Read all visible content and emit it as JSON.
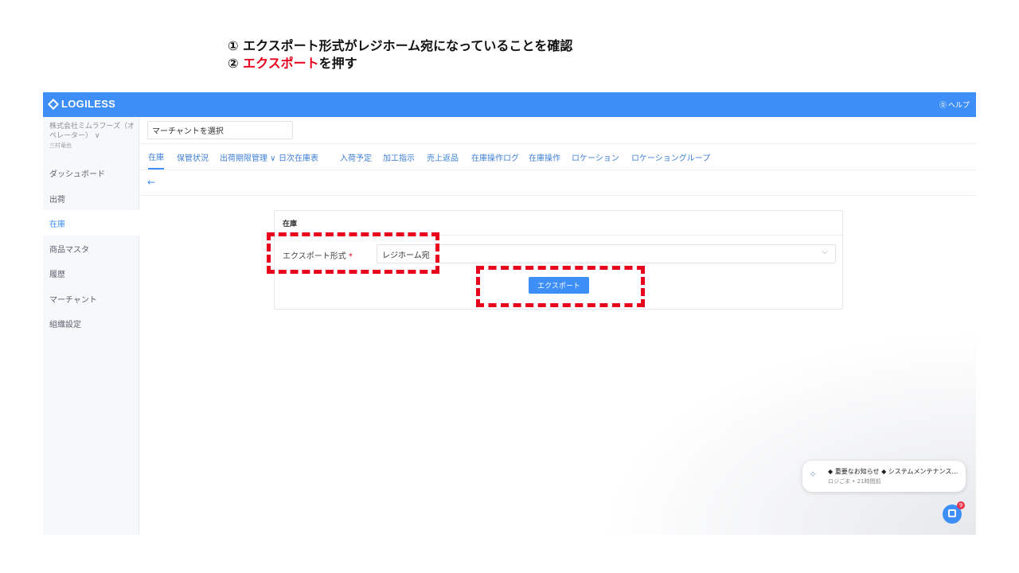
{
  "instructions": {
    "step1": "① エクスポート形式がレジホーム宛になっていることを確認",
    "step2_marker": "② ",
    "step2_red": "エクスポート",
    "step2_rest": "を押す"
  },
  "header": {
    "logo_text": "LOGILESS",
    "help_icon": "question-circle-icon",
    "help_label": "ヘルプ"
  },
  "sidebar": {
    "company_name": "株式会社ミムラフーズ（オペレーター） ∨",
    "user_name": "三村竜也",
    "items": [
      {
        "label": "ダッシュボード"
      },
      {
        "label": "出荷"
      },
      {
        "label": "在庫"
      },
      {
        "label": "商品マスタ"
      },
      {
        "label": "履歴"
      },
      {
        "label": "マーチャント"
      },
      {
        "label": "組織設定"
      }
    ],
    "active_item": "在庫"
  },
  "main": {
    "merchant_placeholder": "マーチャントを選択",
    "tabs": [
      {
        "label": "在庫"
      },
      {
        "label": "保管状況"
      },
      {
        "label": "出荷期限管理 ∨"
      },
      {
        "label": "日次在庫表"
      },
      {
        "label": "入荷予定"
      },
      {
        "label": "加工指示"
      },
      {
        "label": "売上返品"
      },
      {
        "label": "在庫操作ログ"
      },
      {
        "label": "在庫操作"
      },
      {
        "label": "ロケーション"
      },
      {
        "label": "ロケーショングループ"
      }
    ],
    "active_tab": "在庫",
    "back_icon": "arrow-left-icon",
    "back_glyph": "←",
    "card": {
      "title": "在庫",
      "field_label": "エクスポート形式",
      "required_mark": "*",
      "select_value": "レジホーム宛",
      "button_label": "エクスポート"
    }
  },
  "notification": {
    "title": "◆ 重要なお知らせ ◆ システムメンテナンスの...",
    "meta": "ロジごま • 21時間前"
  },
  "chat": {
    "badge_count": "9"
  },
  "colors": {
    "brand": "#3e8ef7",
    "annotation_red": "#e8001c"
  }
}
